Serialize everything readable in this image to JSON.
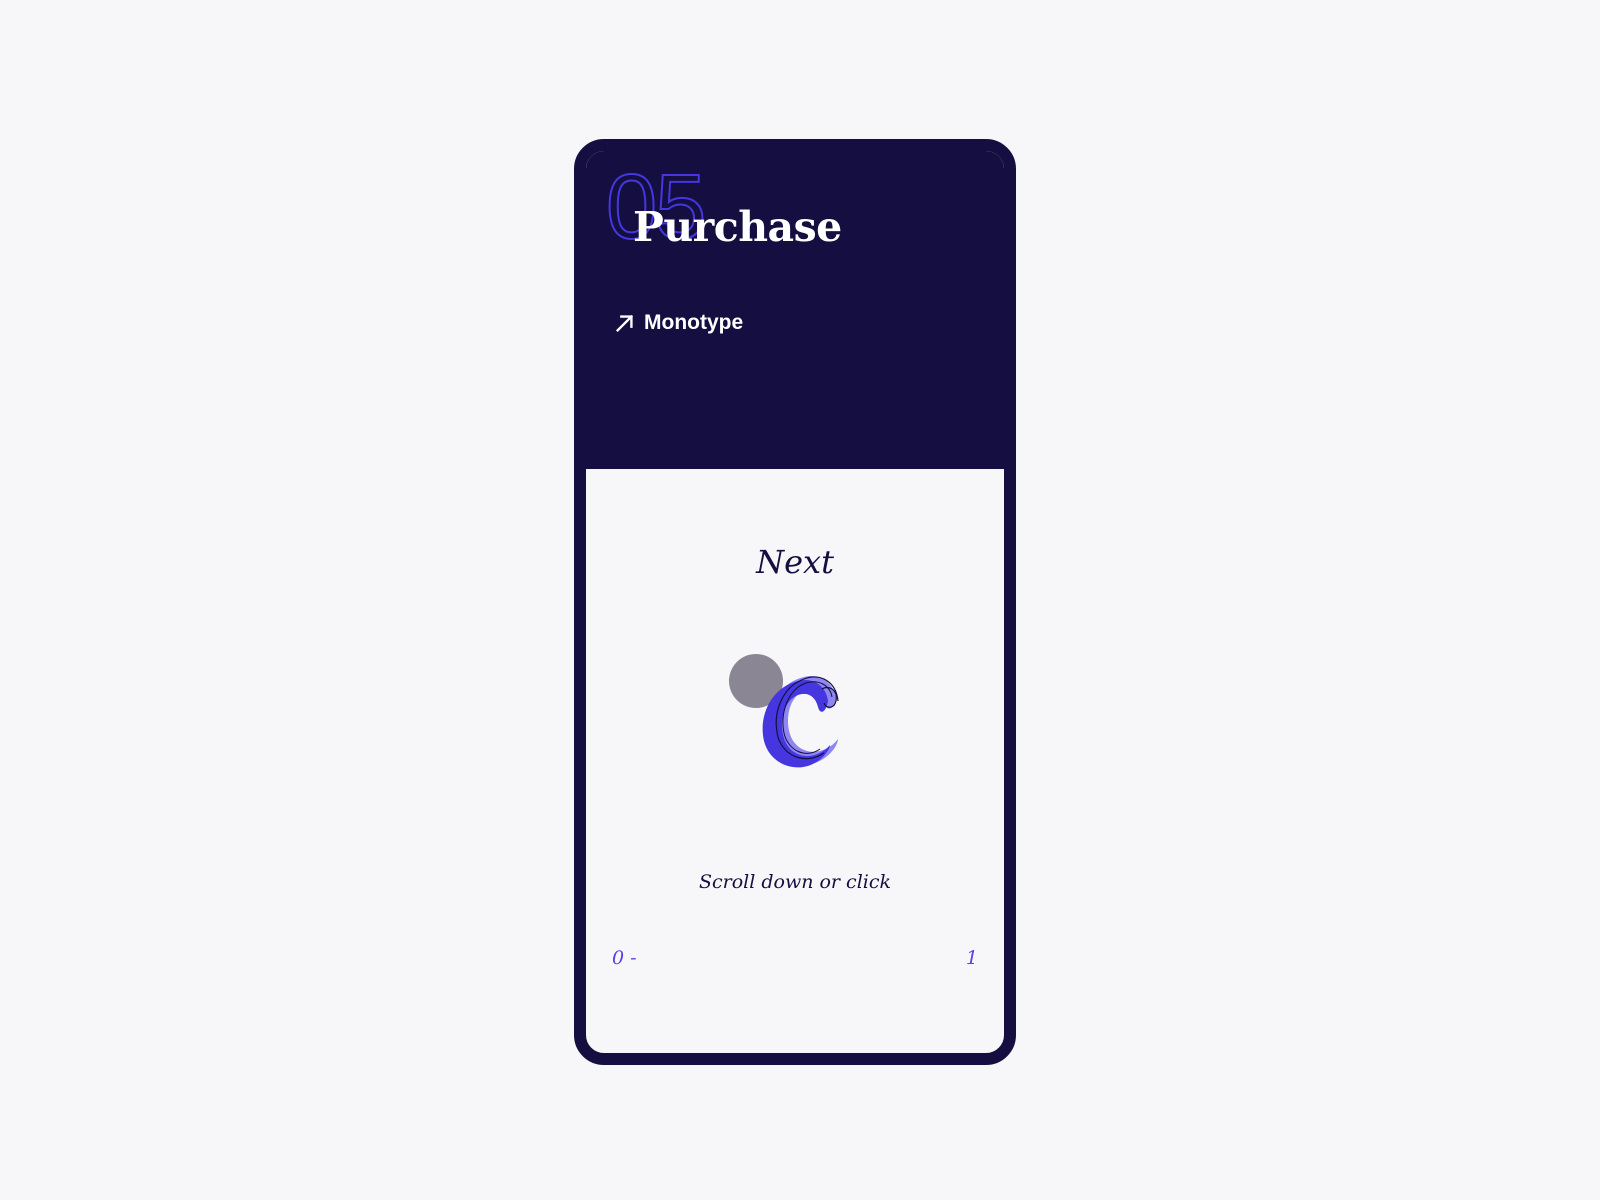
{
  "section": {
    "number": "05",
    "title": "Purchase"
  },
  "link": {
    "label": "Monotype",
    "icon": "arrow-up-right-icon"
  },
  "next": {
    "title": "Next",
    "hint": "Scroll down or click"
  },
  "progress": {
    "start_label": "0 -",
    "end_label": "1"
  },
  "colors": {
    "dark": "#140f40",
    "accent": "#4536e0",
    "accent_light": "#8f86f2",
    "background": "#f7f7f9"
  }
}
